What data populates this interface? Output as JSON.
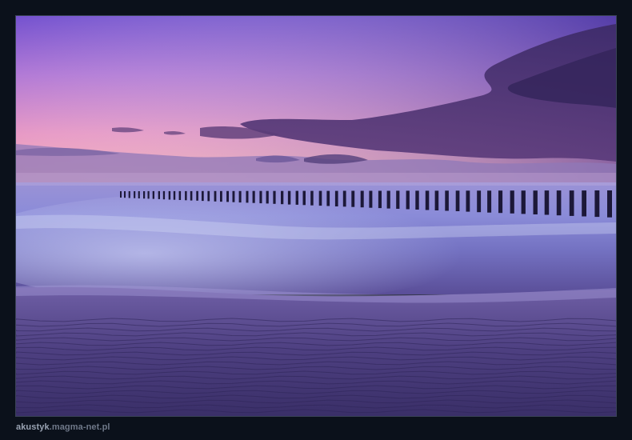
{
  "watermark": {
    "site_name": "akustyk",
    "domain": ".magma-net.pl"
  },
  "photo": {
    "subject": "seascape-sunset-breakwater",
    "colors": {
      "sky_top": "#6a4fc8",
      "sky_mid": "#c08ad8",
      "sky_horizon": "#f2a8bf",
      "cloud": "#4a2f6e",
      "sea": "#8c8fd4",
      "sand": "#4a3f7a",
      "frame": "#0b111b"
    }
  }
}
